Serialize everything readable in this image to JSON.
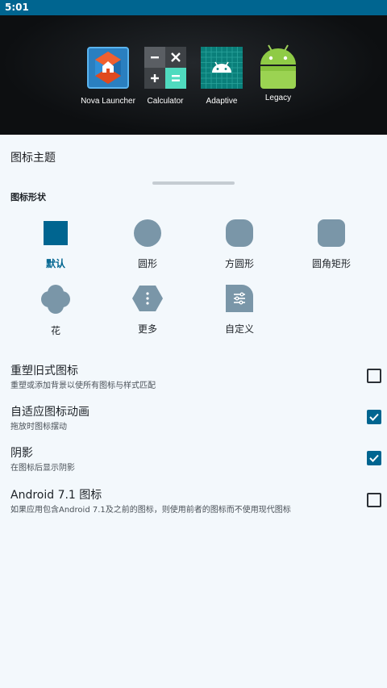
{
  "status_bar": {
    "time": "5:01"
  },
  "preview": {
    "apps": [
      {
        "label": "Nova Launcher",
        "icon": "nova-launcher-icon"
      },
      {
        "label": "Calculator",
        "icon": "calculator-icon"
      },
      {
        "label": "Adaptive",
        "icon": "android-adaptive-icon"
      },
      {
        "label": "Legacy",
        "icon": "android-legacy-icon"
      }
    ]
  },
  "sheet": {
    "title": "图标主题",
    "shape_section": {
      "title": "图标形状",
      "shapes": [
        {
          "label": "默认",
          "icon": "square-shape-icon",
          "selected": true
        },
        {
          "label": "圆形",
          "icon": "circle-shape-icon",
          "selected": false
        },
        {
          "label": "方圆形",
          "icon": "squircle-shape-icon",
          "selected": false
        },
        {
          "label": "圆角矩形",
          "icon": "rounded-rect-shape-icon",
          "selected": false
        },
        {
          "label": "花",
          "icon": "flower-shape-icon",
          "selected": false
        },
        {
          "label": "更多",
          "icon": "more-shape-icon",
          "selected": false
        },
        {
          "label": "自定义",
          "icon": "custom-shape-icon",
          "selected": false
        }
      ]
    },
    "prefs": [
      {
        "title": "重塑旧式图标",
        "summary": "重塑或添加背景以使所有图标与样式匹配",
        "checked": false
      },
      {
        "title": "自适应图标动画",
        "summary": "拖放时图标摆动",
        "checked": true
      },
      {
        "title": "阴影",
        "summary": "在图标后显示阴影",
        "checked": true
      },
      {
        "title": "Android 7.1 图标",
        "summary": "如果应用包含Android 7.1及之前的图标，则使用前者的图标而不使用现代图标",
        "checked": false
      }
    ]
  },
  "colors": {
    "accent": "#006590",
    "shape_fill": "#7a96a8",
    "selected_shape": "#006590"
  }
}
